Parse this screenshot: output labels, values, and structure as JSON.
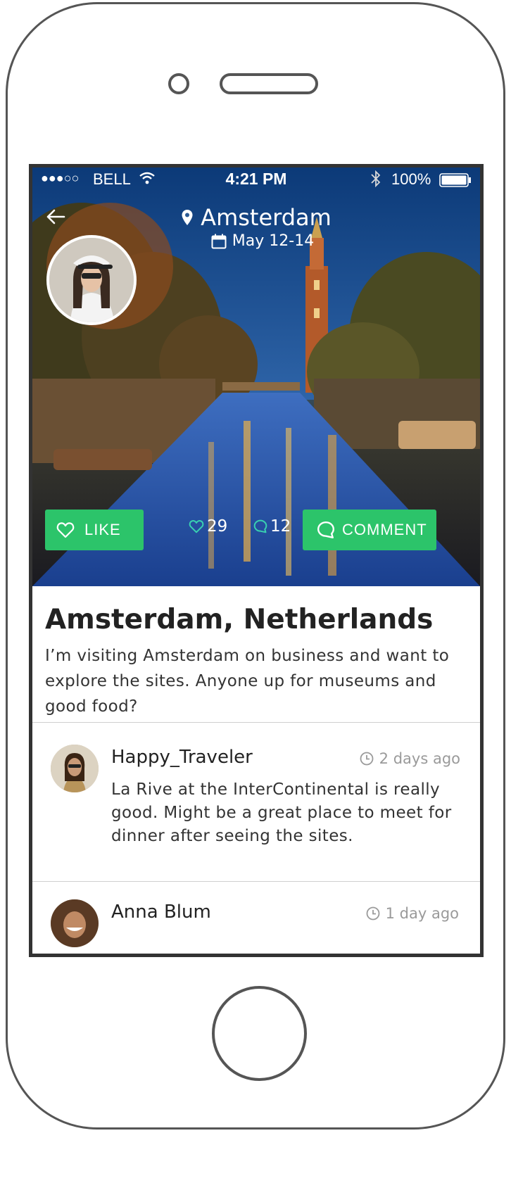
{
  "status_bar": {
    "signal": "●●●○○",
    "carrier": "BELL",
    "time": "4:21 PM",
    "battery": "100%"
  },
  "header": {
    "location": "Amsterdam",
    "dates": "May 12-14"
  },
  "actions": {
    "like_label": "LIKE",
    "likes_count": "29",
    "comments_count": "12",
    "comment_label": "COMMENT"
  },
  "post": {
    "title": "Amsterdam, Netherlands",
    "body": "I’m visiting Amsterdam on business and want to explore the sites. Anyone up for museums and good food?"
  },
  "comments": [
    {
      "user": "Happy_Traveler",
      "time": "2 days ago",
      "text": "La Rive at the InterContinental is really good. Might be a great place to meet for dinner after seeing the sites."
    },
    {
      "user": "Anna Blum",
      "time": "1 day ago",
      "text": ""
    }
  ],
  "colors": {
    "accent": "#2cc46a",
    "text_dark": "#222222",
    "text_muted": "#9a9a9a"
  },
  "icons": {
    "back": "arrow-left-icon",
    "location": "map-pin-icon",
    "calendar": "calendar-icon",
    "like": "heart-icon",
    "comment": "speech-bubble-icon",
    "time": "clock-icon"
  }
}
